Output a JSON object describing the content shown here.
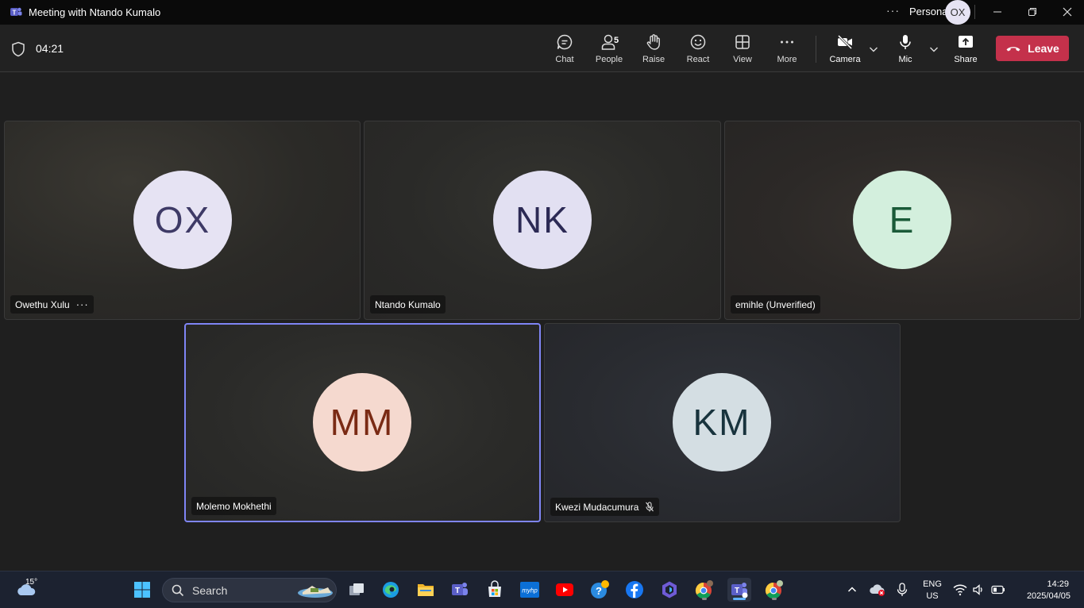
{
  "window": {
    "title": "Meeting with Ntando Kumalo",
    "more_label": "···",
    "account_label": "Personal",
    "account_initials": "OX"
  },
  "toolbar": {
    "timer": "04:21",
    "chat": "Chat",
    "people": "People",
    "people_count": "5",
    "raise": "Raise",
    "react": "React",
    "view": "View",
    "more": "More",
    "camera": "Camera",
    "mic": "Mic",
    "share": "Share",
    "leave": "Leave"
  },
  "participants": [
    {
      "initials": "OX",
      "name": "Owethu Xulu",
      "more_label": "···",
      "avatar_bg": "#e6e3f3",
      "avatar_fg": "#3e3a66"
    },
    {
      "initials": "NK",
      "name": "Ntando Kumalo",
      "avatar_bg": "#e2e0f2",
      "avatar_fg": "#2c2a55"
    },
    {
      "initials": "E",
      "name": "emihle (Unverified)",
      "avatar_bg": "#d3efdd",
      "avatar_fg": "#1a5a38"
    },
    {
      "initials": "MM",
      "name": "Molemo Mokhethi",
      "avatar_bg": "#f5d9cf",
      "avatar_fg": "#7a2a14",
      "speaking": true
    },
    {
      "initials": "KM",
      "name": "Kwezi Mudacumura",
      "avatar_bg": "#d4dee3",
      "avatar_fg": "#18333d",
      "muted": true
    }
  ],
  "taskbar": {
    "weather_temp": "15°",
    "search_label": "Search",
    "lang_line1": "ENG",
    "lang_line2": "US",
    "time": "14:29",
    "date": "2025/04/05"
  },
  "colors": {
    "leave": "#c4314b",
    "active_border": "#7f85f5",
    "teams_purple": "#5b5fc7"
  }
}
